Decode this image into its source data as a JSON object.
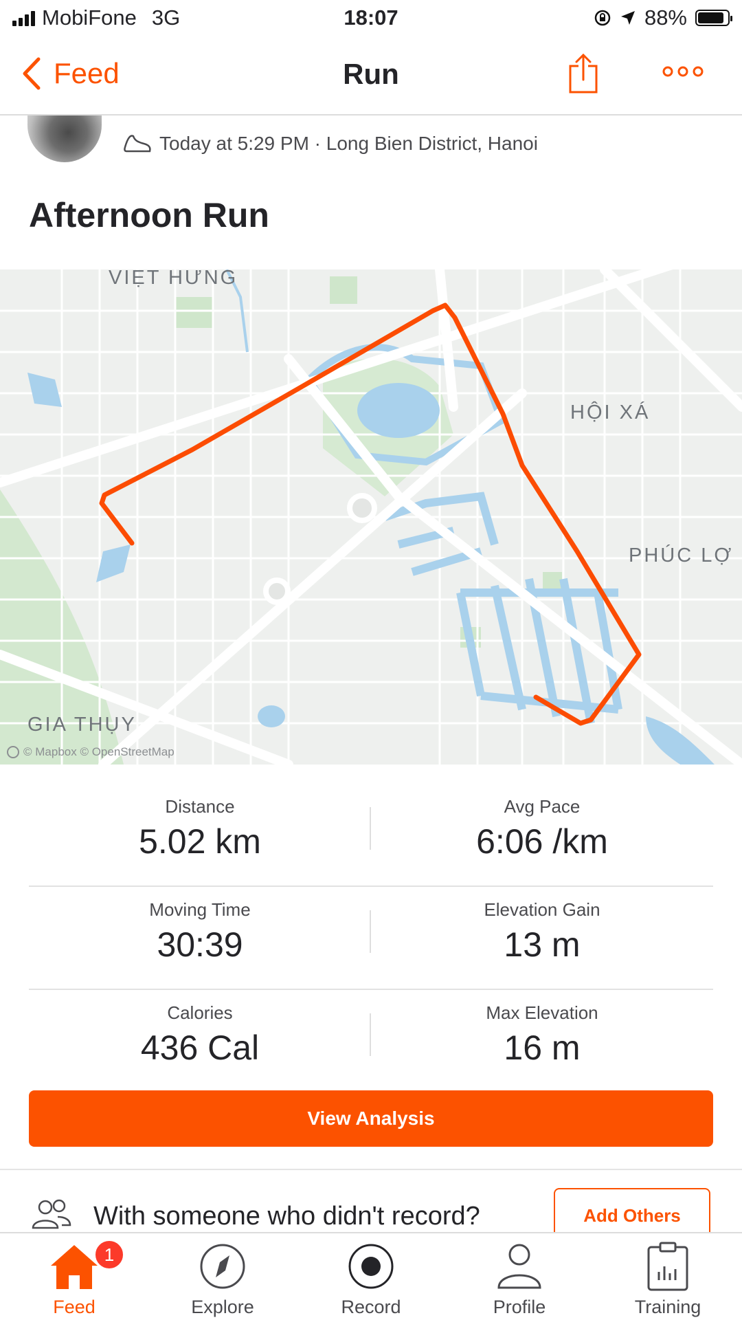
{
  "status_bar": {
    "carrier": "MobiFone",
    "network": "3G",
    "time": "18:07",
    "battery": "88%",
    "battery_level": 0.88
  },
  "nav": {
    "back_label": "Feed",
    "title": "Run"
  },
  "activity": {
    "meta": "Today at 5:29 PM · Long Bien District, Hanoi",
    "title": "Afternoon Run"
  },
  "map": {
    "labels": {
      "viet_hung": "VIỆT HƯNG",
      "hoi_xa": "HỘI XÁ",
      "phuc_loi": "PHÚC LỢ",
      "gia_thuy": "GIA THỤY"
    },
    "attribution": "© Mapbox © OpenStreetMap",
    "route_color": "#fc4c02"
  },
  "stats": [
    {
      "label": "Distance",
      "value": "5.02 km"
    },
    {
      "label": "Avg Pace",
      "value": "6:06 /km"
    },
    {
      "label": "Moving Time",
      "value": "30:39"
    },
    {
      "label": "Elevation Gain",
      "value": "13 m"
    },
    {
      "label": "Calories",
      "value": "436 Cal"
    },
    {
      "label": "Max Elevation",
      "value": "16 m"
    }
  ],
  "cta": {
    "label": "View Analysis"
  },
  "with_others": {
    "text": "With someone who didn't record?",
    "button": "Add Others"
  },
  "tabs": [
    {
      "label": "Feed",
      "badge": "1"
    },
    {
      "label": "Explore"
    },
    {
      "label": "Record"
    },
    {
      "label": "Profile"
    },
    {
      "label": "Training"
    }
  ],
  "colors": {
    "accent": "#fc5200",
    "badge": "#fc3a2a"
  }
}
